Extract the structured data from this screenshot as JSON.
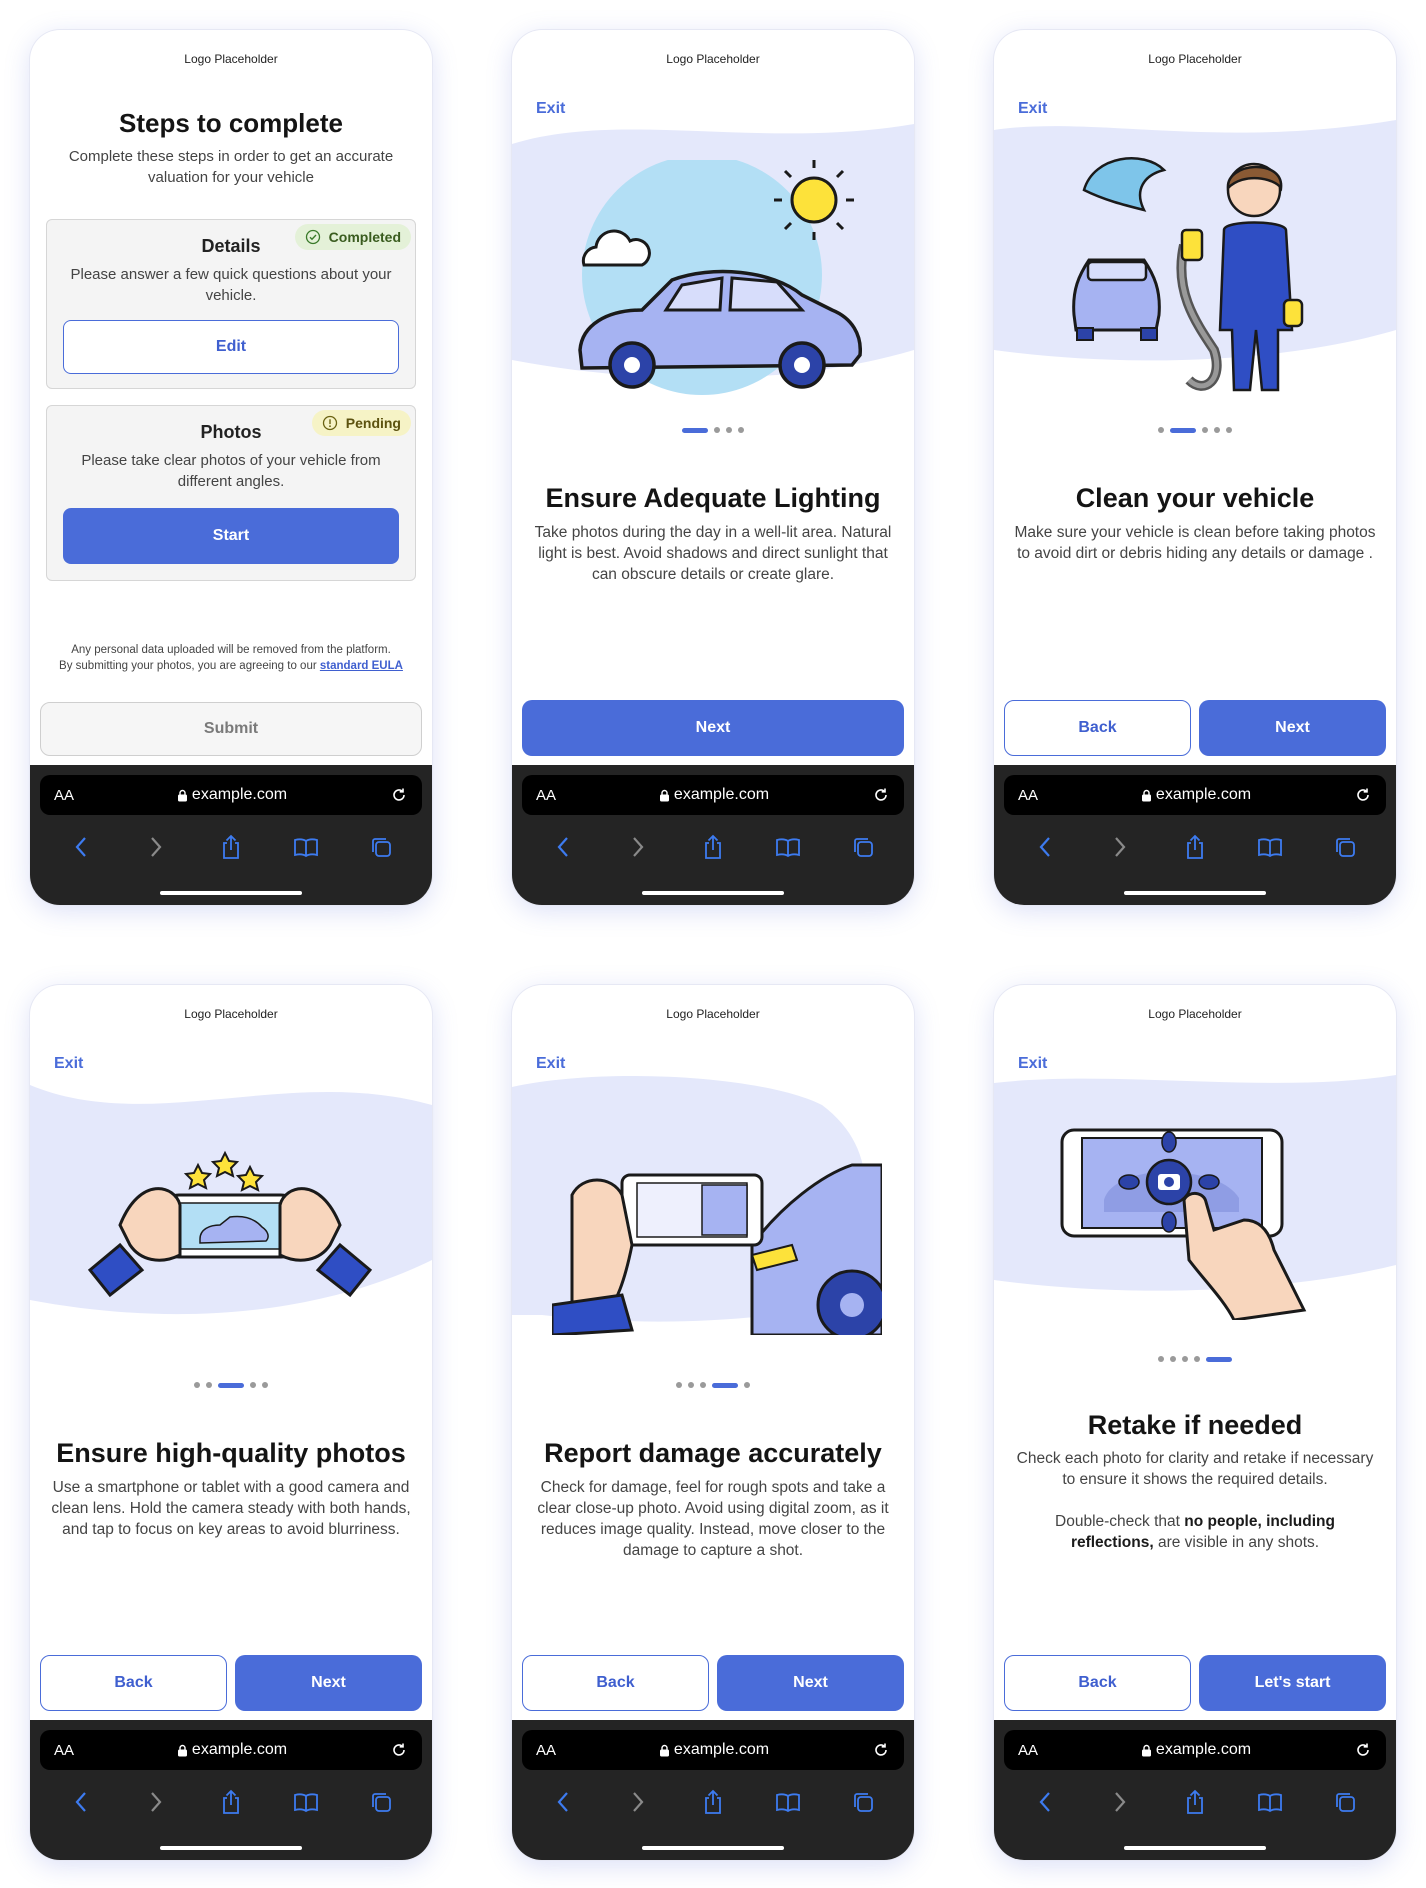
{
  "logo": "Logo Placeholder",
  "exit_label": "Exit",
  "browser": {
    "aa": "AA",
    "url": "example.com"
  },
  "steps": {
    "title": "Steps to complete",
    "subtitle": "Complete these steps in order to get an accurate valuation for your vehicle",
    "details": {
      "title": "Details",
      "status": "Completed",
      "text": "Please answer a few quick questions about your vehicle.",
      "button": "Edit"
    },
    "photos": {
      "title": "Photos",
      "status": "Pending",
      "text": "Please take clear photos of your vehicle from different angles.",
      "button": "Start"
    },
    "disclaimer_line1": "Any personal data uploaded will be removed from the platform.",
    "disclaimer_line2": "By submitting your photos, you are agreeing to our",
    "eula_link": "standard EULA",
    "submit": "Submit"
  },
  "lighting": {
    "title": "Ensure Adequate Lighting",
    "text": "Take photos during the day in a well-lit area. Natural light is best. Avoid shadows and direct sunlight that can obscure details or create glare.",
    "next": "Next"
  },
  "clean": {
    "title": "Clean your vehicle",
    "text": "Make sure your vehicle is clean before taking photos to avoid dirt or debris hiding any details or damage .",
    "back": "Back",
    "next": "Next"
  },
  "quality": {
    "title": "Ensure high-quality photos",
    "text": "Use a smartphone or tablet with a good camera and clean lens. Hold the camera steady with both hands, and tap to focus on key areas to avoid blurriness.",
    "back": "Back",
    "next": "Next"
  },
  "damage": {
    "title": "Report damage accurately",
    "text": "Check for damage, feel for rough spots and take a clear close-up photo. Avoid using digital zoom, as it reduces image quality. Instead, move closer to the damage to capture a shot.",
    "back": "Back",
    "next": "Next"
  },
  "retake": {
    "title": "Retake if needed",
    "text1": "Check each photo for clarity and retake if necessary to ensure it shows the required details.",
    "text2_pre": "Double-check that",
    "text2_bold": "no people, including reflections,",
    "text2_post": "are visible in any shots.",
    "back": "Back",
    "start": "Let's start"
  },
  "carousel": {
    "total_dots": 5,
    "active_index": {
      "lighting": 1,
      "clean": 2,
      "quality": 3,
      "damage": 4,
      "retake": 5
    }
  },
  "colors": {
    "accent": "#4a6cd9",
    "completed_bg": "#e4f1d8",
    "pending_bg": "#f6f3c6",
    "wave": "#e4e8fb"
  }
}
